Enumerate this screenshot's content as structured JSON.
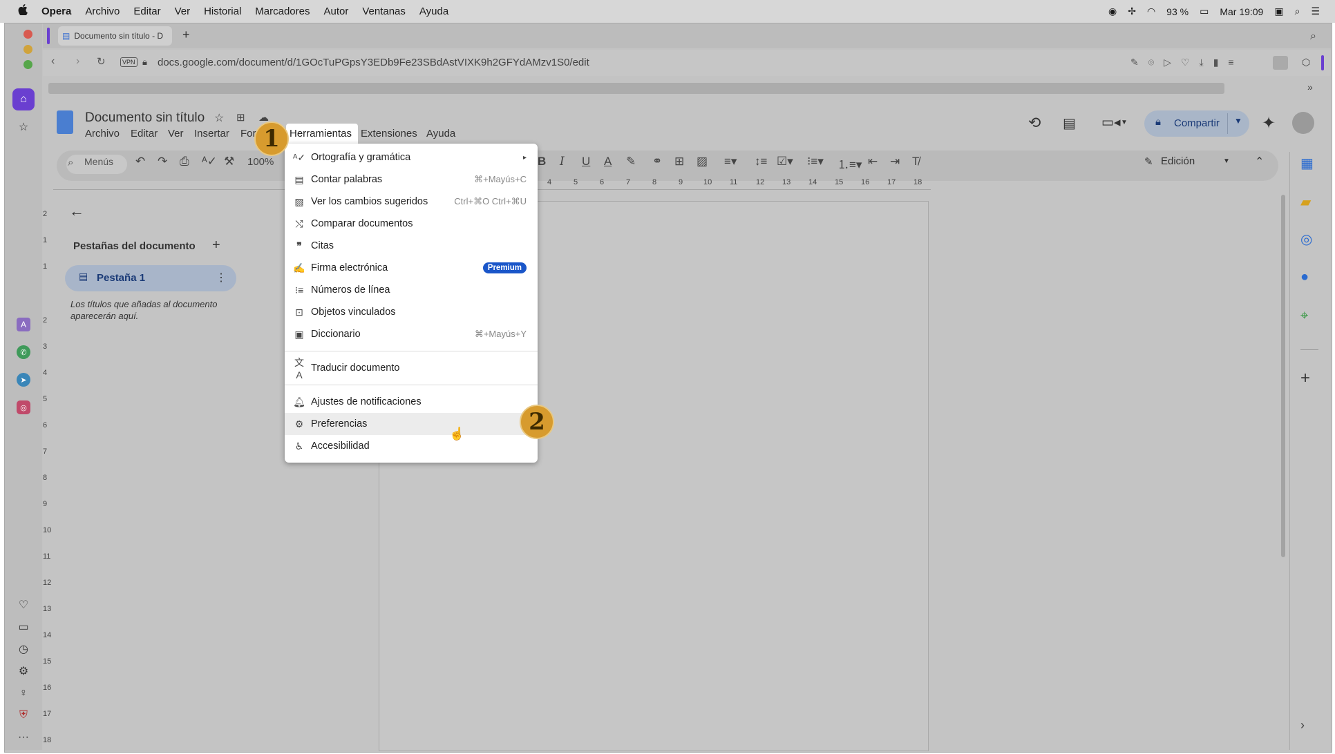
{
  "macos_menubar": {
    "apple": "",
    "app": "Opera",
    "items": [
      "Archivo",
      "Editar",
      "Ver",
      "Historial",
      "Marcadores",
      "Autor",
      "Ventanas",
      "Ayuda"
    ],
    "battery": "93 %",
    "clock": "Mar 19:09"
  },
  "browser": {
    "tab_title": "Documento sin título - D",
    "new_tab": "+",
    "vpn": "VPN",
    "url": "docs.google.com/document/d/1GOcTuPGpsY3EDb9Fe23SBdAstVIXK9h2GFYdAMzv1S0/edit"
  },
  "docs": {
    "title": "Documento sin título",
    "menus": [
      "Archivo",
      "Editar",
      "Ver",
      "Insertar",
      "For",
      "Herramientas",
      "Extensiones",
      "Ayuda"
    ],
    "toolbar": {
      "search_label": "Menús",
      "zoom": "100%",
      "edit_mode": "Edición"
    },
    "share_label": "Compartir",
    "ruler_ticks": [
      "4",
      "5",
      "6",
      "7",
      "8",
      "9",
      "10",
      "11",
      "12",
      "13",
      "14",
      "15",
      "16",
      "17",
      "18"
    ],
    "vruler_ticks": [
      "2",
      "1",
      "1",
      "2",
      "3",
      "4",
      "5",
      "6",
      "7",
      "8",
      "9",
      "10",
      "11",
      "12",
      "13",
      "14",
      "15",
      "16",
      "17",
      "18"
    ]
  },
  "left_panel": {
    "title": "Pestañas del documento",
    "add": "+",
    "tab_label": "Pestaña 1",
    "hint": "Los títulos que añadas al documento aparecerán aquí."
  },
  "tools_menu": {
    "items": [
      {
        "label": "Ortografía y gramática",
        "shortcut": "▸",
        "icon": "spellcheck-icon"
      },
      {
        "label": "Contar palabras",
        "shortcut": "⌘+Mayús+C",
        "icon": "word-count-icon"
      },
      {
        "label": "Ver los cambios sugeridos",
        "shortcut": "Ctrl+⌘O Ctrl+⌘U",
        "icon": "suggested-changes-icon"
      },
      {
        "label": "Comparar documentos",
        "shortcut": "",
        "icon": "compare-icon"
      },
      {
        "label": "Citas",
        "shortcut": "",
        "icon": "quote-icon"
      },
      {
        "label": "Firma electrónica",
        "shortcut": "",
        "icon": "signature-icon"
      },
      {
        "label": "Números de línea",
        "shortcut": "",
        "icon": "line-numbers-icon"
      },
      {
        "label": "Objetos vinculados",
        "shortcut": "",
        "icon": "linked-objects-icon"
      },
      {
        "label": "Diccionario",
        "shortcut": "⌘+Mayús+Y",
        "icon": "dictionary-icon"
      },
      {
        "label": "Traducir documento",
        "shortcut": "",
        "icon": "translate-icon"
      },
      {
        "label": "Ajustes de notificaciones",
        "shortcut": "",
        "icon": "bell-icon"
      },
      {
        "label": "Preferencias",
        "shortcut": "",
        "icon": "preferences-icon"
      },
      {
        "label": "Accesibilidad",
        "shortcut": "",
        "icon": "accessibility-icon"
      }
    ],
    "premium_badge": "Premium"
  },
  "annotations": {
    "step1": "1",
    "step2": "2"
  },
  "colors": {
    "accent": "#1a56c9",
    "badge": "#d79b2e",
    "highlight": "#ececec"
  }
}
